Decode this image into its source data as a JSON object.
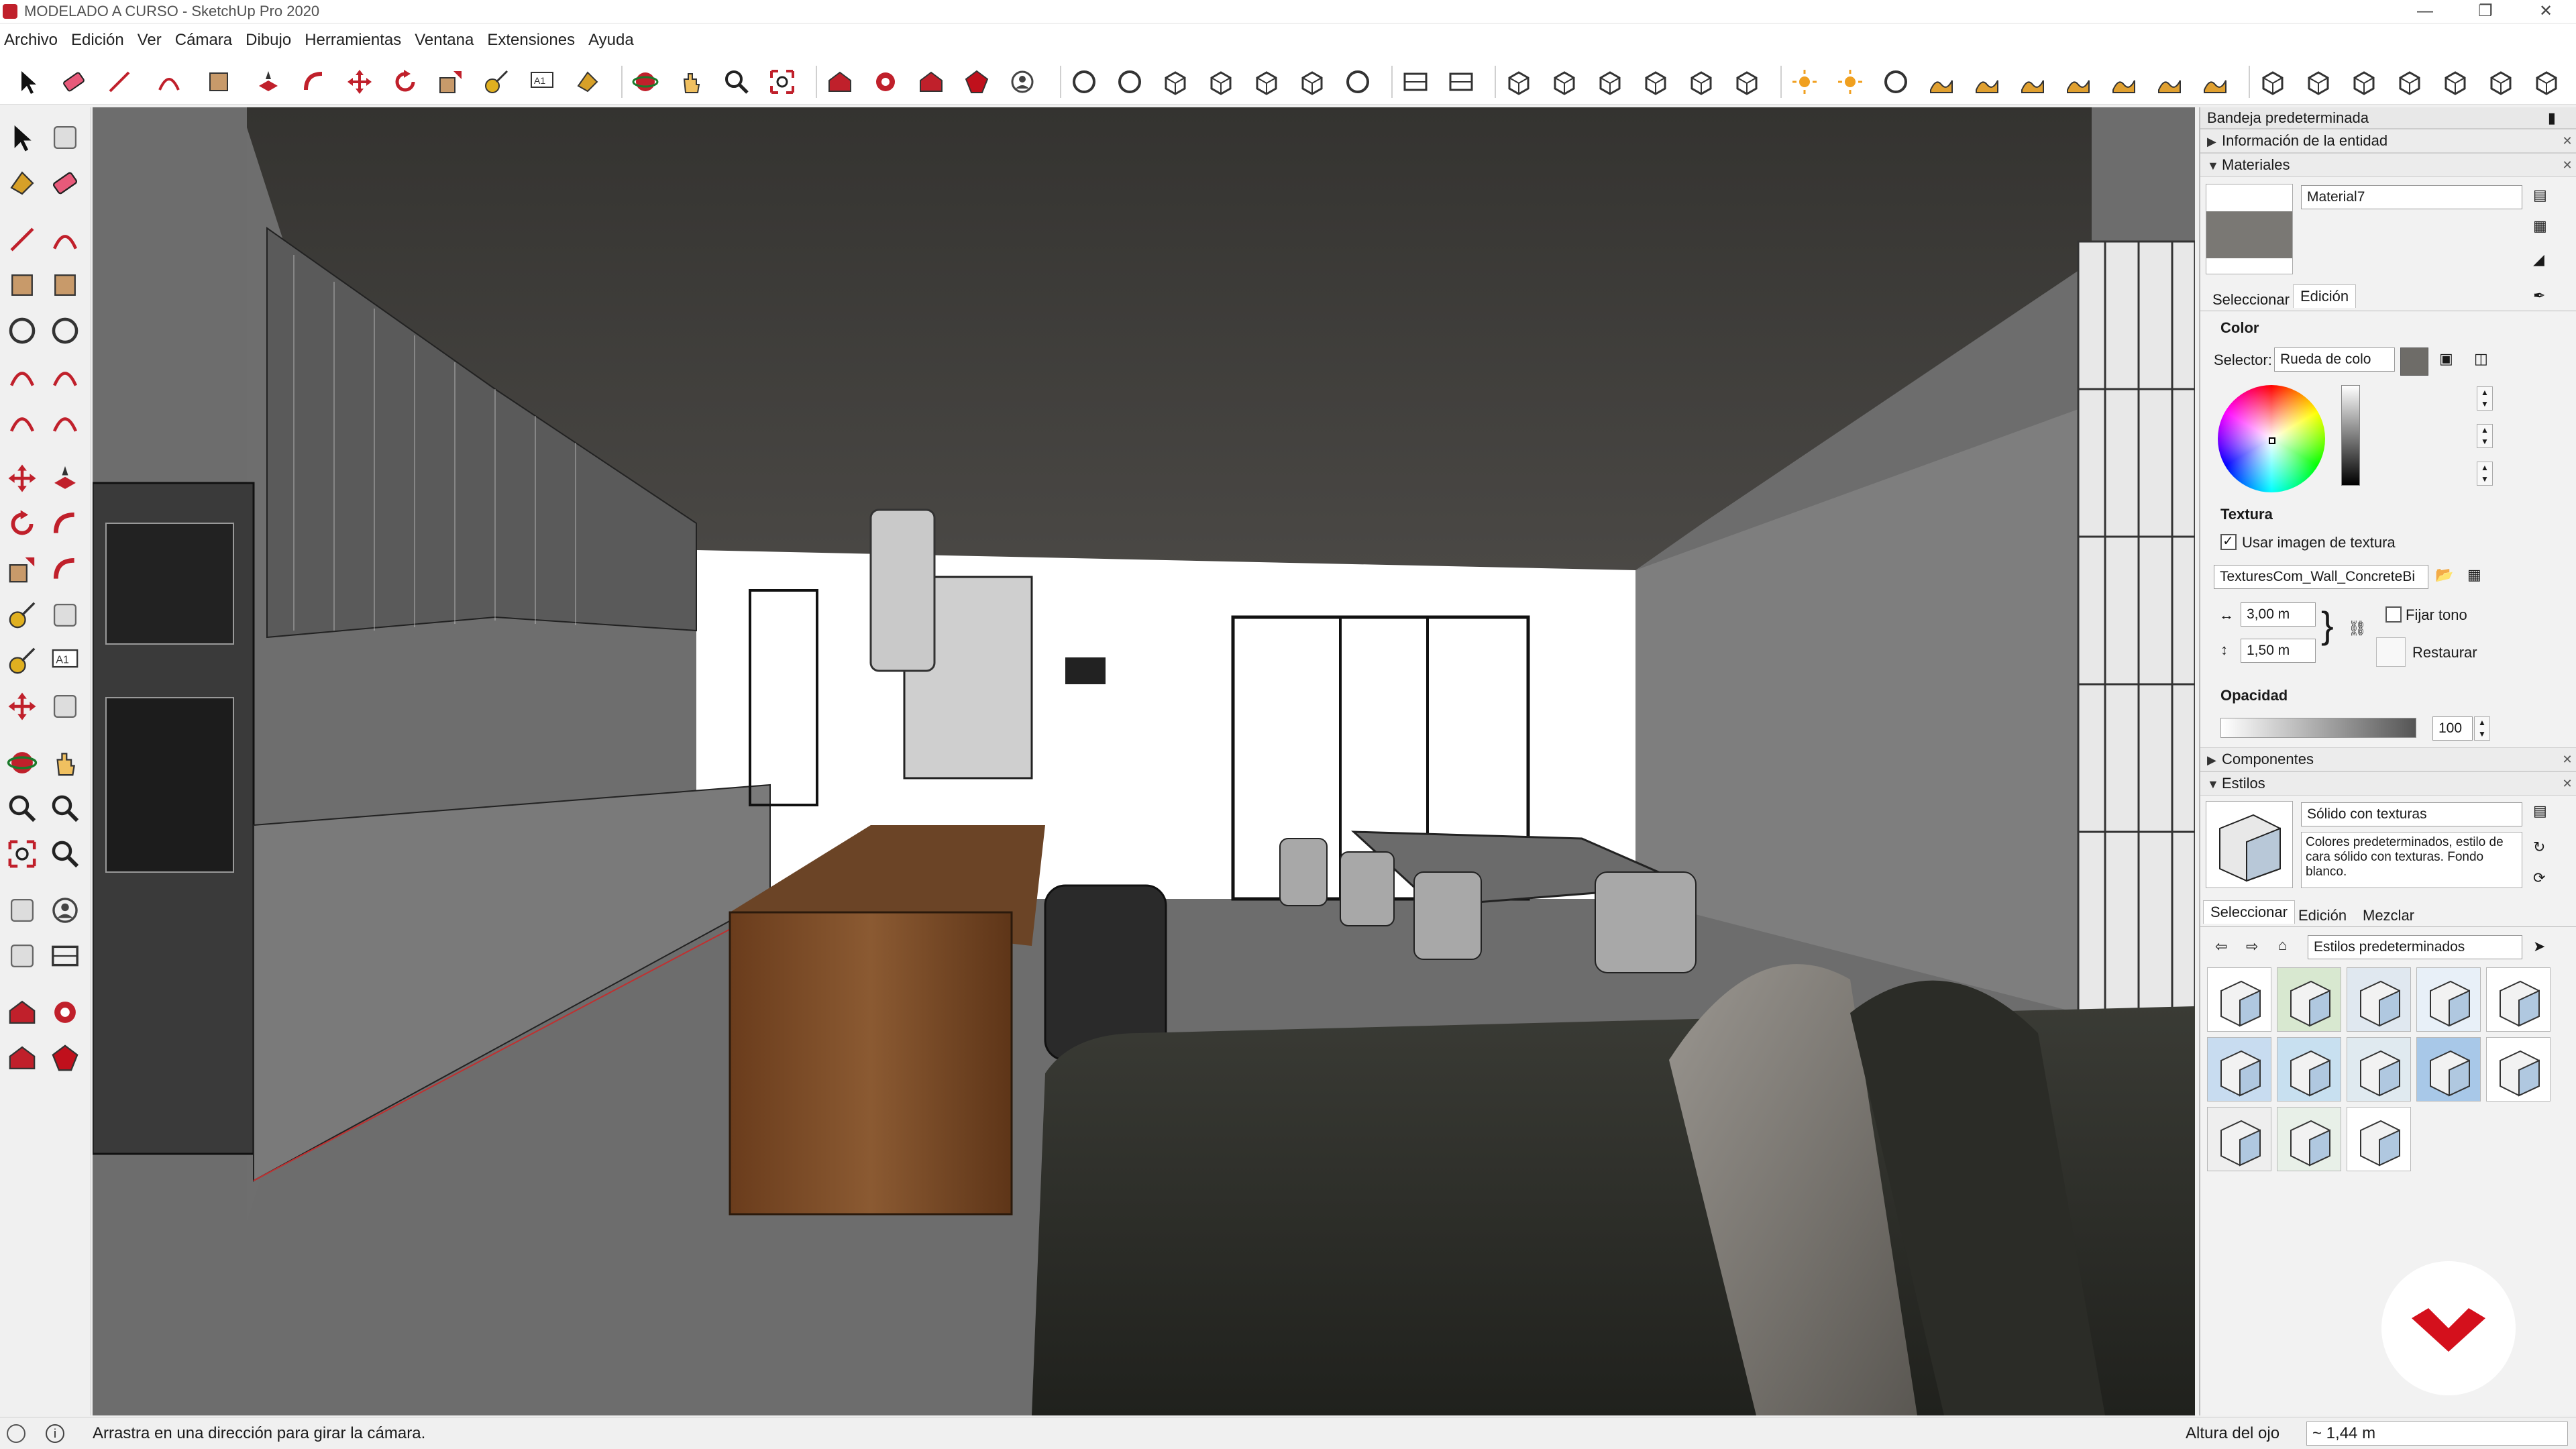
{
  "window": {
    "title": "MODELADO A CURSO - SketchUp Pro 2020"
  },
  "menu": [
    "Archivo",
    "Edición",
    "Ver",
    "Cámara",
    "Dibujo",
    "Herramientas",
    "Ventana",
    "Extensiones",
    "Ayuda"
  ],
  "tray": {
    "title": "Bandeja predeterminada",
    "sections": {
      "entity_info": "Información de la entidad",
      "materials": "Materiales",
      "components": "Componentes",
      "styles": "Estilos"
    },
    "materials": {
      "name": "Material7",
      "tabs": [
        "Seleccionar",
        "Edición"
      ],
      "active_tab": "Edición",
      "color_heading": "Color",
      "selector_label": "Selector:",
      "selector_value": "Rueda de colo",
      "texture_heading": "Textura",
      "use_texture_label": "Usar imagen de textura",
      "use_texture_checked": true,
      "texture_file": "TexturesCom_Wall_ConcreteBi",
      "width": "3,00 m",
      "height": "1,50 m",
      "fix_hue_label": "Fijar tono",
      "reset_label": "Restaurar",
      "opacity_heading": "Opacidad",
      "opacity_value": "100",
      "swatch_color": "#6e6c68"
    },
    "styles": {
      "name": "Sólido con texturas",
      "description": "Colores predeterminados, estilo de cara sólido con texturas. Fondo blanco.",
      "tabs": [
        "Seleccionar",
        "Edición",
        "Mezclar"
      ],
      "active_tab": "Seleccionar",
      "collection": "Estilos predeterminados"
    }
  },
  "status": {
    "message": "Arrastra en una dirección para girar la cámara.",
    "measure_label": "Altura del ojo",
    "measure_value": "~ 1,44 m"
  },
  "colors": {
    "accent": "#c0202b",
    "ceiling": "#3b3a37",
    "floor": "#6a6a6a",
    "wood": "#7a4a26",
    "sofa": "#2f302a"
  }
}
